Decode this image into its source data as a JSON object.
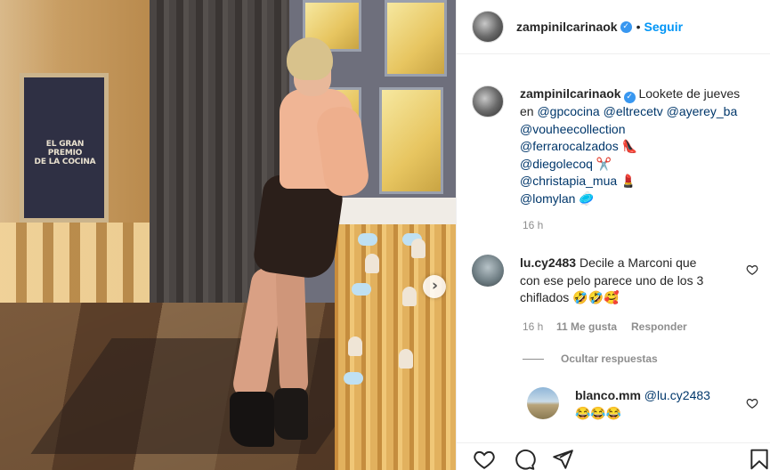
{
  "post": {
    "username": "zampinilcarinaok",
    "follow_label": "Seguir",
    "separator": "•",
    "sign_text": [
      "EL GRAN PREMIO",
      "DE LA COCINA"
    ]
  },
  "caption": {
    "username": "zampinilcarinaok",
    "line1": "Lookete de jueves",
    "line2_prefix": "en",
    "mentions": [
      "@gpcocina",
      "@eltrecetv",
      "@ayerey_ba",
      "@vouheecollection",
      "@ferrarocalzados",
      "@diegolecoq",
      "@christapia_mua",
      "@lomylan"
    ],
    "emojis": [
      "👠",
      "✂️",
      "💄",
      "🥏"
    ],
    "time": "16 h"
  },
  "comment1": {
    "username": "lu.cy2483",
    "lines": [
      "Decile a Marconi que",
      "con ese pelo parece uno de los 3",
      "chiflados"
    ],
    "emojis": "🤣🤣🥰",
    "time": "16 h",
    "likes": "11 Me gusta",
    "reply": "Responder"
  },
  "hide_replies": "Ocultar respuestas",
  "reply1": {
    "username": "blanco.mm",
    "mention": "@lu.cy2483",
    "emojis": "😂😂😂"
  },
  "icons": {
    "like": "heart-icon",
    "comment": "comment-icon",
    "share": "share-icon",
    "save": "bookmark-icon",
    "next": "chevron-right-icon"
  },
  "colors": {
    "link": "#0095f6",
    "mention": "#00376b",
    "verified": "#3897f0",
    "muted": "#8e8e8e"
  }
}
